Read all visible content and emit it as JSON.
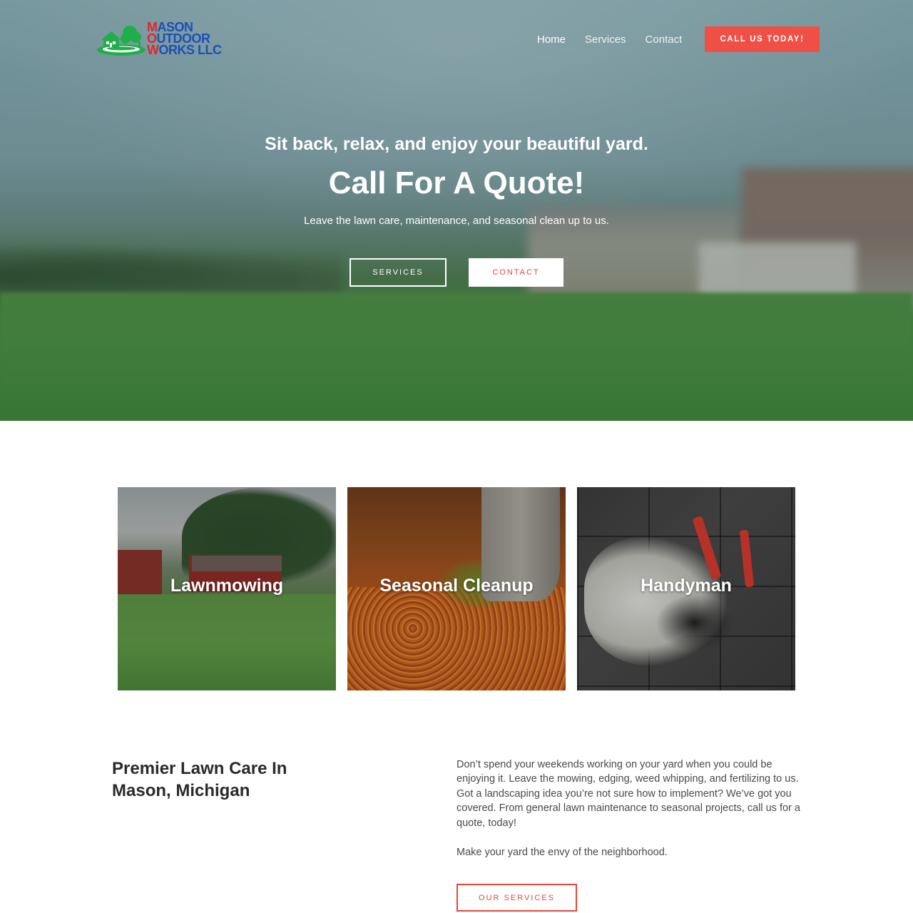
{
  "brand": {
    "logo_line1": "MASON",
    "logo_line2": "OUTDOOR",
    "logo_line3": "WORKS LLC",
    "colors": {
      "accent_red": "#ef4f45",
      "logo_blue": "#1d4fb8",
      "logo_green": "#1fae4a"
    }
  },
  "nav": {
    "items": [
      {
        "label": "Home",
        "active": true
      },
      {
        "label": "Services",
        "active": false
      },
      {
        "label": "Contact",
        "active": false
      }
    ],
    "cta_label": "CALL US TODAY!"
  },
  "hero": {
    "subtitle": "Sit back, relax, and enjoy your beautiful yard.",
    "title": "Call For A Quote!",
    "description": "Leave the lawn care, maintenance, and seasonal clean up to us.",
    "services_button": "SERVICES",
    "contact_button": "CONTACT"
  },
  "services": {
    "cards": [
      {
        "label": "Lawnmowing",
        "icon": "lawn-photo"
      },
      {
        "label": "Seasonal Cleanup",
        "icon": "leaves-photo"
      },
      {
        "label": "Handyman",
        "icon": "gloves-tools-photo"
      }
    ]
  },
  "about": {
    "title_line1": "Premier Lawn Care In",
    "title_line2": "Mason, Michigan",
    "paragraph1": "Don’t spend your weekends working on your yard when you could be enjoying it. Leave the mowing, edging, weed whipping, and fertilizing to us. Got a landscaping idea you’re not sure how to implement? We’ve got you covered. From general lawn maintenance to seasonal projects, call us for a quote, today!",
    "paragraph2": "Make your yard the envy of the neighborhood.",
    "button_label": "OUR SERVICES"
  }
}
